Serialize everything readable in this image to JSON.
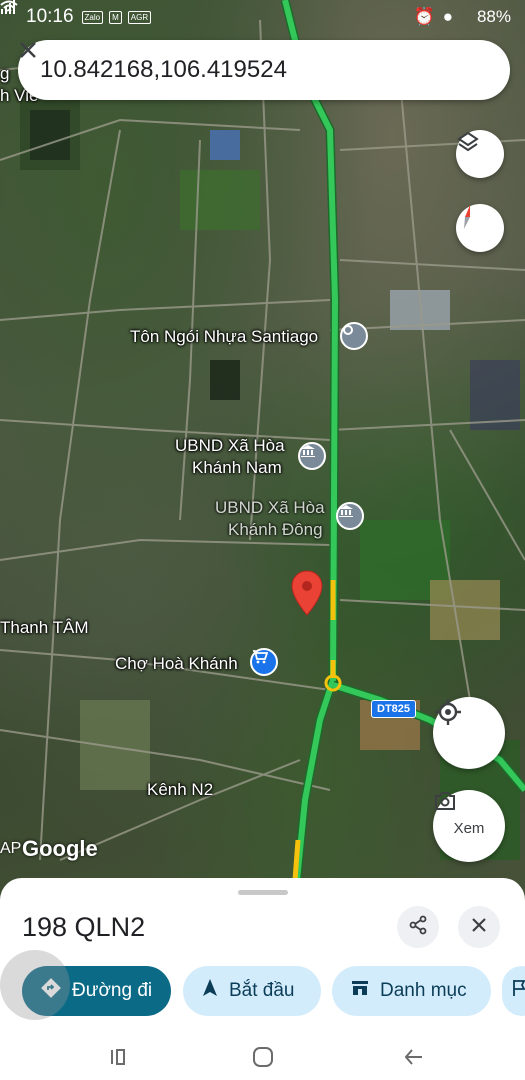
{
  "status_bar": {
    "time": "10:16",
    "app_icons": [
      "Zalo",
      "M",
      "AGR"
    ],
    "battery": "88%"
  },
  "search": {
    "query": "10.842168,106.419524"
  },
  "map": {
    "labels": {
      "santiago": "Tôn Ngói Nhựa Santiago",
      "ubnd_line1": "UBND Xã Hòa",
      "ubnd_line2": "Khánh Nam",
      "ubnd_ha_line1": "UBND Xã Hòa",
      "ubnd_ha_line2": "Khánh Đông",
      "thanh_tam": "Thanh TÂM",
      "cho": "Chợ Hoà Khánh",
      "kenh": "Kênh N2",
      "road_badge": "DT825",
      "logo": "Google",
      "logo_prefix": "AP",
      "top_left_1": "g",
      "top_left_2": "h Viê"
    },
    "buttons": {
      "explore_label": "Xem"
    },
    "colors": {
      "route": "#34c759",
      "pin": "#ea4335",
      "poi": "#7a8a99",
      "shopping": "#1a73e8"
    }
  },
  "sheet": {
    "title": "198 QLN2",
    "chips": {
      "directions": "Đường đi",
      "start": "Bắt đầu",
      "category": "Danh mục"
    }
  }
}
